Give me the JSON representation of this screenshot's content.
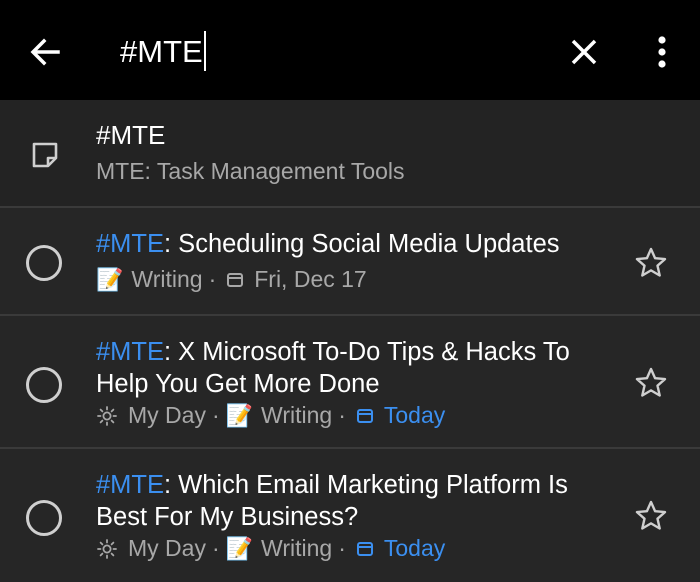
{
  "search": {
    "query": "#MTE"
  },
  "note": {
    "title": "#MTE",
    "subtitle": "MTE: Task Management Tools",
    "icon": "sticky-note-icon"
  },
  "tasks": [
    {
      "tag": "#MTE",
      "title": ": Scheduling Social Media Updates",
      "list": "Writing",
      "list_icon": "memo-icon",
      "due": "Fri, Dec 17",
      "due_highlight": false
    },
    {
      "tag": "#MTE",
      "title": ": X Microsoft To-Do Tips & Hacks To Help You Get More Done",
      "my_day": "My Day",
      "list": "Writing",
      "list_icon": "memo-icon",
      "due": "Today",
      "due_highlight": true
    },
    {
      "tag": "#MTE",
      "title": ": Which Email Marketing Platform Is Best For My Business?",
      "my_day": "My Day",
      "list": "Writing",
      "list_icon": "memo-icon",
      "due": "Today",
      "due_highlight": true
    }
  ],
  "colors": {
    "topbar": "#000000",
    "background": "#262626",
    "accent": "#3b8ff0",
    "muted_text": "#a8a8a8"
  }
}
